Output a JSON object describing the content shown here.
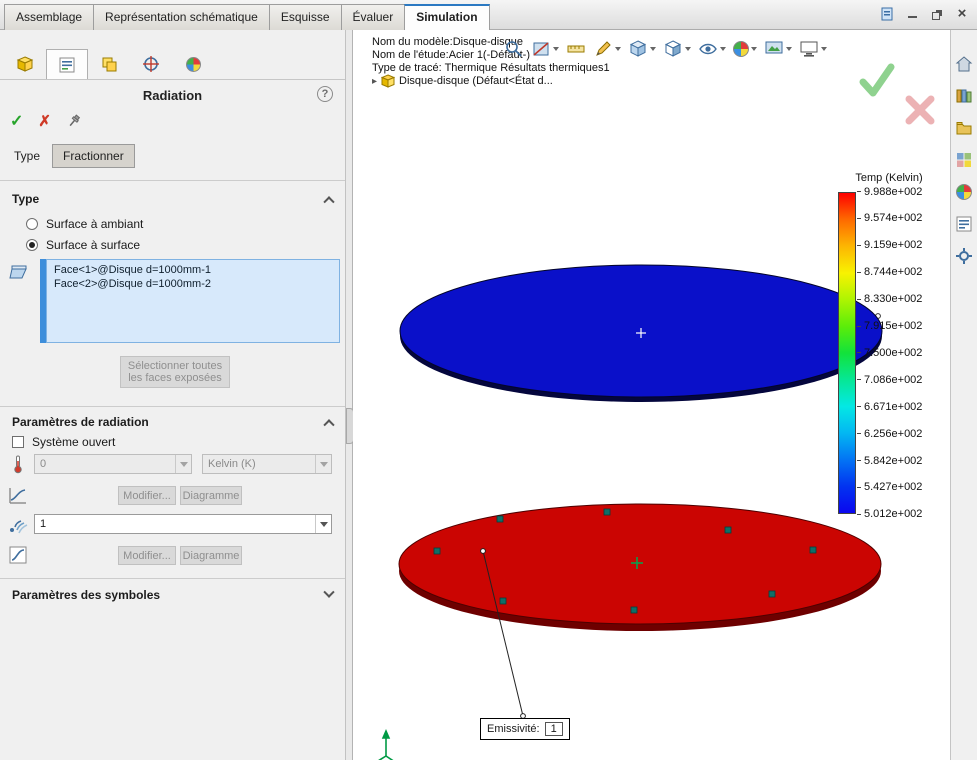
{
  "command_tabs": {
    "items": [
      "Assemblage",
      "Représentation schématique",
      "Esquisse",
      "Évaluer",
      "Simulation"
    ]
  },
  "icons": {
    "ok": "✓",
    "cancel": "✗",
    "help": "?",
    "close": "×",
    "tree_arrow": "▸"
  },
  "property_panel": {
    "title": "Radiation",
    "mode_tabs": {
      "type": "Type",
      "split": "Fractionner"
    },
    "type_section": {
      "header": "Type",
      "radio_ambient": "Surface à ambiant",
      "radio_surface": "Surface à surface",
      "faces": [
        "Face<1>@Disque d=1000mm-1",
        "Face<2>@Disque d=1000mm-2"
      ],
      "select_all_button": "Sélectionner toutes les faces exposées"
    },
    "radiation_section": {
      "header": "Paramètres de radiation",
      "open_system_label": "Système ouvert",
      "ambient_temperature_value": "0",
      "unit_value": "Kelvin (K)",
      "modify_button": "Modifier...",
      "diagram_button": "Diagramme",
      "view_factor_value": "1"
    },
    "symbols_section": {
      "header": "Paramètres des symboles"
    }
  },
  "viewport": {
    "info_lines": {
      "model": "Nom du modèle:Disque-disque",
      "study": "Nom de l'étude:Acier 1(-Défaut-)",
      "plot": "Type de tracé: Thermique Résultats thermiques1"
    },
    "tree_item": "Disque-disque (Défaut<État d...",
    "callout": {
      "label": "Emissivité:",
      "value": "1"
    },
    "disk_top_color": "#0a10c9",
    "disk_bottom_color": "#cb0502"
  },
  "legend": {
    "title": "Temp (Kelvin)",
    "values": [
      "9.988e+002",
      "9.574e+002",
      "9.159e+002",
      "8.744e+002",
      "8.330e+002",
      "7.915e+002",
      "7.500e+002",
      "7.086e+002",
      "6.671e+002",
      "6.256e+002",
      "5.842e+002",
      "5.427e+002",
      "5.012e+002"
    ],
    "colors": [
      "#fe0000",
      "#fe6a00",
      "#fdb602",
      "#f8f201",
      "#aef402",
      "#5ced09",
      "#12e23b",
      "#06e795",
      "#04e8e4",
      "#03b7f2",
      "#0374f4",
      "#0233f0",
      "#0b07ef"
    ]
  }
}
